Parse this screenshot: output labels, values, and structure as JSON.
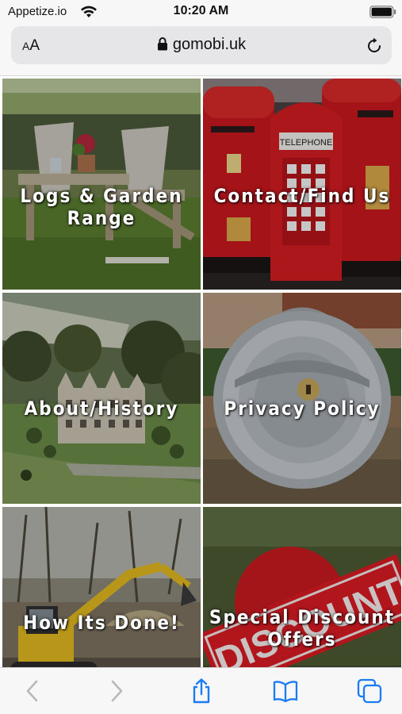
{
  "status_bar": {
    "carrier": "Appetize.io",
    "time": "10:20 AM"
  },
  "address_bar": {
    "text_size_label_small": "A",
    "text_size_label_large": "A",
    "url": "gomobi.uk"
  },
  "tiles": [
    {
      "label": "Logs & Garden Range"
    },
    {
      "label": "Contact/Find Us"
    },
    {
      "label": "About/History"
    },
    {
      "label": "Privacy Policy"
    },
    {
      "label": "How Its Done!"
    },
    {
      "label": "Special Discount Offers"
    }
  ],
  "images": {
    "post_box_sign": "TELEPHONE",
    "discount_sign": "DISCOUNT"
  },
  "toolbar": {
    "icons": [
      "back-icon",
      "forward-icon",
      "share-icon",
      "bookmarks-icon",
      "tabs-icon"
    ]
  },
  "colors": {
    "accent": "#1a7cf5",
    "disabled": "#b8b8bd",
    "postbox_red": "#c8181e"
  }
}
